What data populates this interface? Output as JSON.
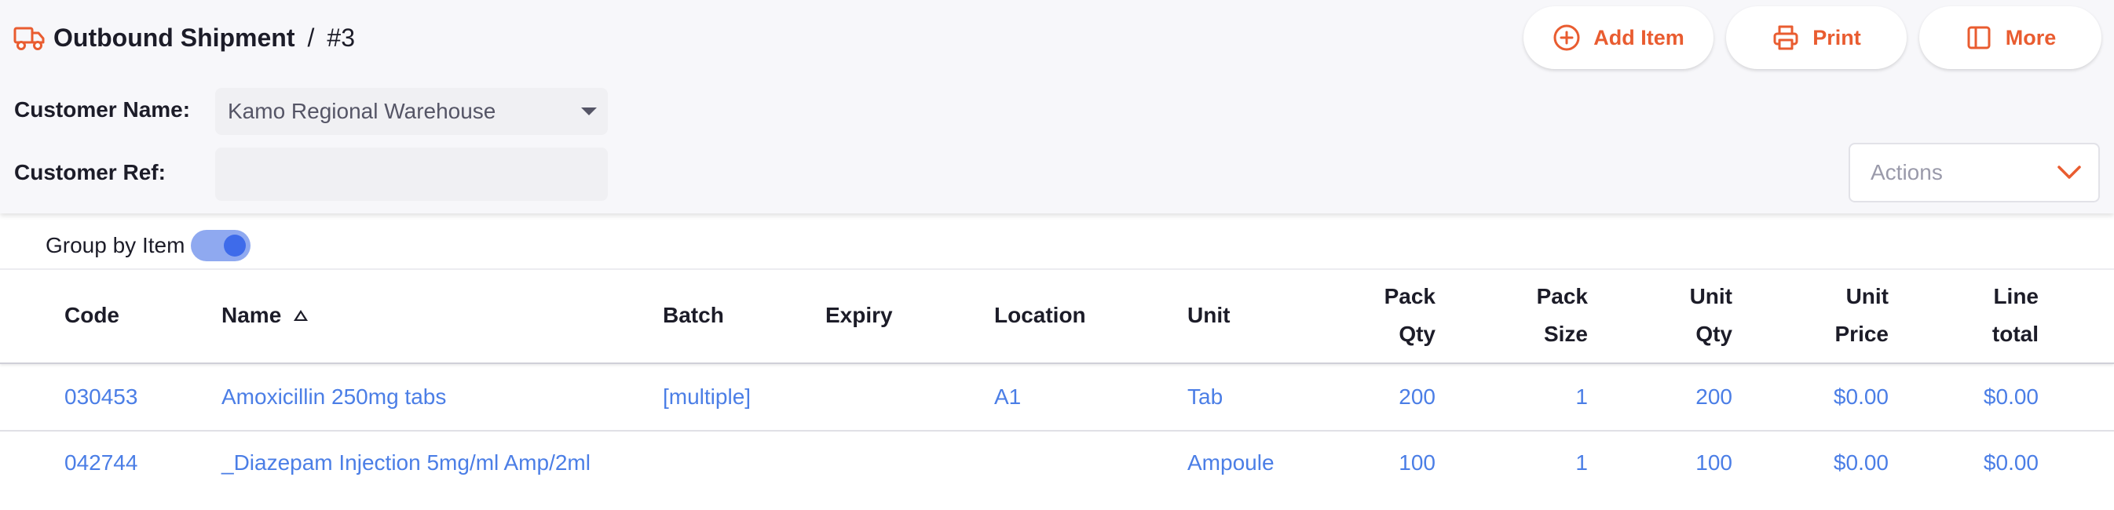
{
  "header": {
    "title": "Outbound Shipment",
    "separator": "/",
    "number": "#3",
    "accent_color": "#e95c30",
    "icon": "truck-icon"
  },
  "toolbar": {
    "add_item_label": "Add Item",
    "print_label": "Print",
    "more_label": "More"
  },
  "form": {
    "customer_name_label": "Customer Name:",
    "customer_name_value": "Kamo Regional Warehouse",
    "customer_ref_label": "Customer Ref:",
    "customer_ref_value": ""
  },
  "actions": {
    "placeholder": "Actions"
  },
  "group_by": {
    "label": "Group by Item",
    "enabled": true
  },
  "table": {
    "headers": {
      "code": "Code",
      "name": "Name",
      "batch": "Batch",
      "expiry": "Expiry",
      "location": "Location",
      "unit": "Unit",
      "pack_qty": [
        "Pack",
        "Qty"
      ],
      "pack_size": [
        "Pack",
        "Size"
      ],
      "unit_qty": [
        "Unit",
        "Qty"
      ],
      "unit_price": [
        "Unit",
        "Price"
      ],
      "line_total": [
        "Line",
        "total"
      ]
    },
    "sort": {
      "column": "name",
      "direction": "ascending"
    },
    "rows": [
      {
        "code": "030453",
        "name": "Amoxicillin 250mg tabs",
        "batch": "[multiple]",
        "expiry": "",
        "location": "A1",
        "unit": "Tab",
        "pack_qty": "200",
        "pack_size": "1",
        "unit_qty": "200",
        "unit_price": "$0.00",
        "line_total": "$0.00"
      },
      {
        "code": "042744",
        "name": "_Diazepam Injection 5mg/ml Amp/2ml",
        "batch": "",
        "expiry": "",
        "location": "",
        "unit": "Ampoule",
        "pack_qty": "100",
        "pack_size": "1",
        "unit_qty": "100",
        "unit_price": "$0.00",
        "line_total": "$0.00"
      }
    ]
  }
}
